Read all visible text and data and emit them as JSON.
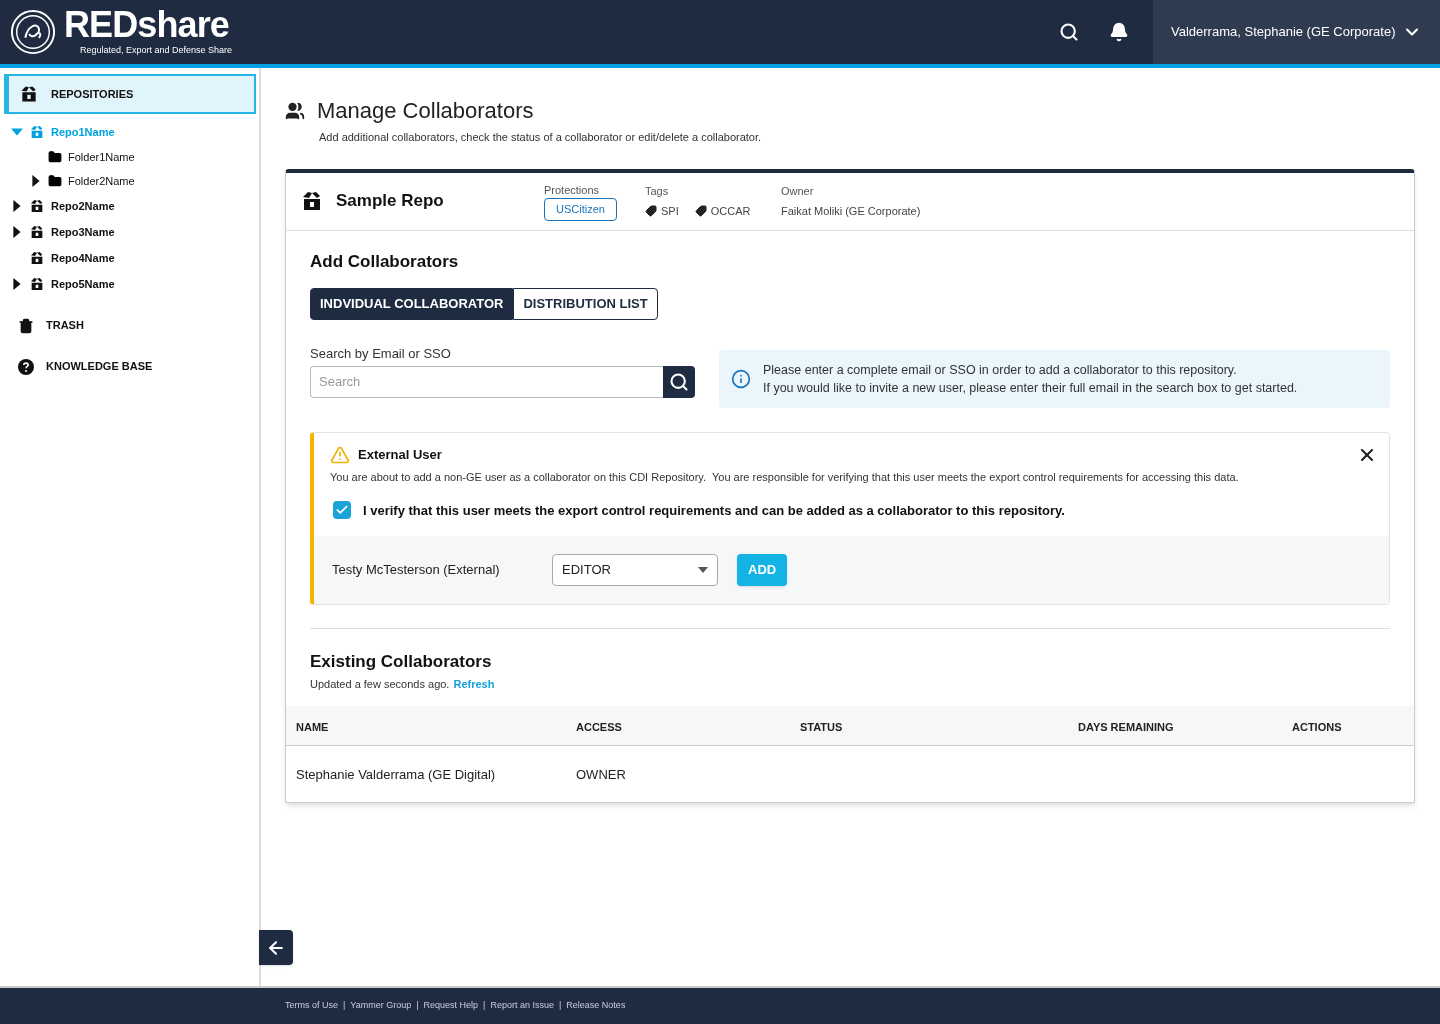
{
  "header": {
    "brand": "REDshare",
    "tagline": "Regulated, Export and Defense Share",
    "user": "Valderrama, Stephanie (GE Corporate)"
  },
  "sidebar": {
    "repositories": {
      "label": "REPOSITORIES",
      "selected": true,
      "items": [
        {
          "label": "Repo1Name",
          "kind": "repo",
          "selected": true,
          "expanded": true,
          "children": [
            {
              "label": "Folder1Name",
              "kind": "folder",
              "selected": false
            },
            {
              "label": "Folder2Name",
              "kind": "folder",
              "selected": false,
              "expanded": false
            }
          ]
        },
        {
          "label": "Repo2Name",
          "kind": "repo",
          "selected": false,
          "expanded": false
        },
        {
          "label": "Repo3Name",
          "kind": "repo",
          "selected": false,
          "expanded": false
        },
        {
          "label": "Repo4Name",
          "kind": "repo",
          "selected": false
        },
        {
          "label": "Repo5Name",
          "kind": "repo",
          "selected": false,
          "expanded": false
        }
      ]
    },
    "links": [
      {
        "label": "TRASH",
        "kind": "trash"
      },
      {
        "label": "KNOWLEDGE BASE",
        "kind": "help"
      }
    ]
  },
  "page": {
    "title": "Manage Collaborators",
    "subtitle": "Add additional collaborators, check the status of a collaborator or edit/delete a collaborator."
  },
  "repo": {
    "name": "Sample Repo",
    "protections_label": "Protections",
    "protections": [
      "USCitizen"
    ],
    "tags_label": "Tags",
    "tags": [
      "SPI",
      "OCCAR"
    ],
    "owner_label": "Owner",
    "owner": "Faikat Moliki (GE Corporate)"
  },
  "add": {
    "title": "Add Collaborators",
    "tabs": [
      {
        "label": "INDVIDUAL COLLABORATOR",
        "selected": true
      },
      {
        "label": "DISTRIBUTION LIST",
        "selected": false
      }
    ],
    "search_label": "Search by Email or SSO",
    "search": {
      "placeholder": "Search"
    },
    "info": [
      "Please enter a complete email or SSO in order to add a collaborator to this repository.",
      "If you would like to invite a new user, please enter their full email in the search box to get started."
    ]
  },
  "alert": {
    "title": "External User",
    "message": "You are about to add a non-GE user as a collaborator on this CDI Repository.  You are responsible for verifying that this user meets the export control requirements for accessing this data.",
    "verify": {
      "label": "I verify that this user meets the export control requirements and can be added as a collaborator to this repository.",
      "checked": true
    },
    "user": "Testy McTesterson (External)",
    "role": "EDITOR",
    "add_button": "ADD"
  },
  "existing": {
    "title": "Existing Collaborators",
    "updated": "Updated a few seconds ago.",
    "refresh": "Refresh",
    "columns": [
      "NAME",
      "ACCESS",
      "STATUS",
      "DAYS REMAINING",
      "ACTIONS"
    ],
    "rows": [
      [
        "Stephanie Valderrama (GE Digital)",
        "OWNER",
        "",
        "",
        ""
      ]
    ]
  },
  "footer": {
    "links": [
      "Terms of Use",
      "Yammer Group",
      "Request Help",
      "Report an Issue",
      "Release Notes"
    ],
    "separator": "|"
  }
}
